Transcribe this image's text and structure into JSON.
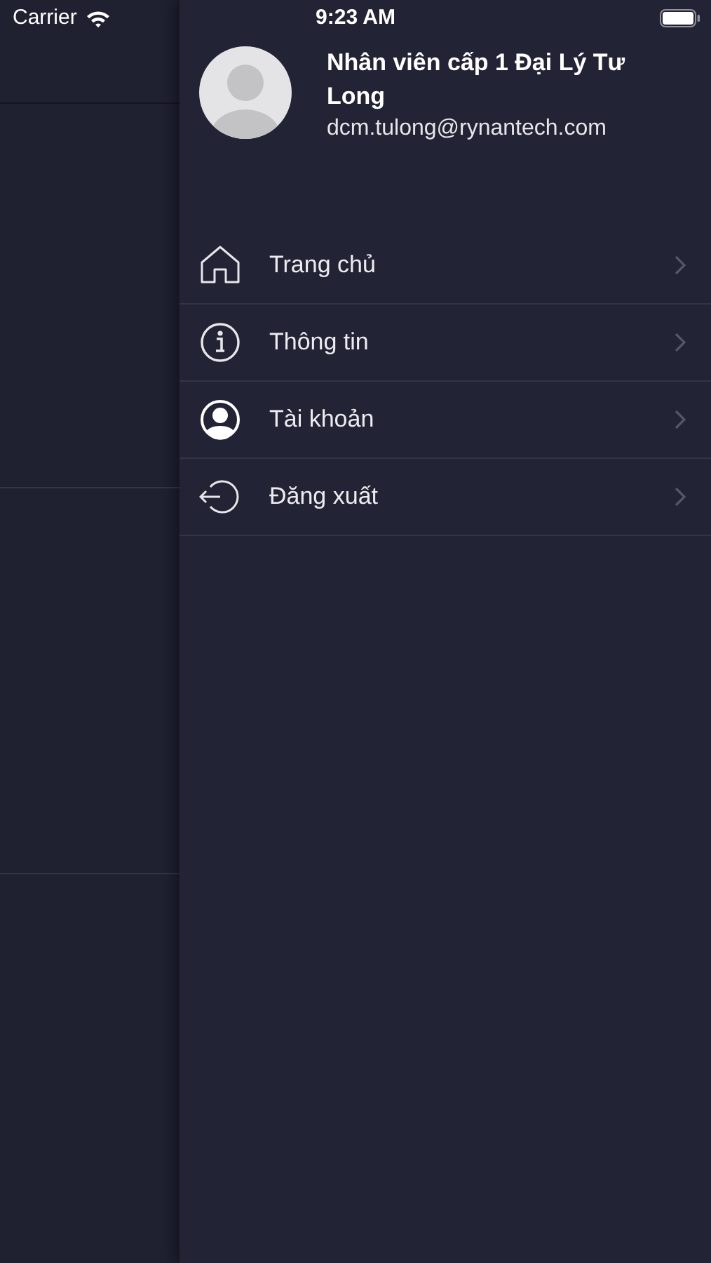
{
  "status_bar": {
    "carrier": "Carrier",
    "time": "9:23 AM"
  },
  "drawer": {
    "user_name": "Nhân viên cấp 1 Đại Lý Tư Long",
    "email": "dcm.tulong@rynantech.com",
    "menu": [
      {
        "label": "Trang chủ",
        "kind": "home"
      },
      {
        "label": "Thông tin",
        "kind": "info"
      },
      {
        "label": "Tài khoản",
        "kind": "account"
      },
      {
        "label": "Đăng xuất",
        "kind": "logout"
      }
    ]
  }
}
